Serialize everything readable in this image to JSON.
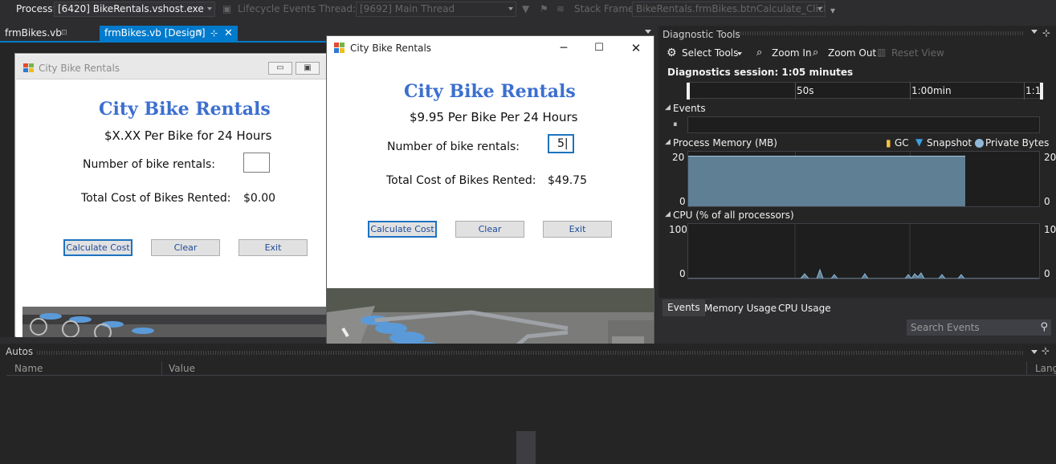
{
  "toolbar": {
    "process_label": "Process:",
    "process_value": "[6420] BikeRentals.vshost.exe",
    "lifecycle_label": "Lifecycle Events",
    "thread_label": "Thread:",
    "thread_value": "[9692] Main Thread",
    "stackframe_label": "Stack Frame:",
    "stackframe_value": "BikeRentals.frmBikes.btnCalculate_Click"
  },
  "tabs": [
    {
      "label": "frmBikes.vb"
    },
    {
      "label": "frmBikes.vb [Design]"
    }
  ],
  "design_form": {
    "title": "City Bike Rentals",
    "heading": "City Bike Rentals",
    "price_text": "$X.XX Per Bike for 24 Hours",
    "rentals_label": "Number of bike rentals:",
    "rentals_value": "",
    "total_label": "Total Cost of Bikes Rented:",
    "total_value": "$0.00",
    "calculate_label": "Calculate Cost",
    "clear_label": "Clear",
    "exit_label": "Exit"
  },
  "run_form": {
    "title": "City Bike Rentals",
    "heading": "City Bike Rentals",
    "price_text": "$9.95 Per Bike Per 24 Hours",
    "rentals_label": "Number of bike rentals:",
    "rentals_value": "5",
    "total_label": "Total Cost of Bikes Rented:",
    "total_value": "$49.75",
    "calculate_label": "Calculate Cost",
    "clear_label": "Clear",
    "exit_label": "Exit"
  },
  "diagnostics": {
    "title": "Diagnostic Tools",
    "select_tools": "Select Tools",
    "zoom_in": "Zoom In",
    "zoom_out": "Zoom Out",
    "reset_view": "Reset View",
    "session": "Diagnostics session: 1:05 minutes",
    "ruler_ticks": [
      "50s",
      "1:00min",
      "1:1"
    ],
    "events_label": "Events",
    "memory_label": "Process Memory (MB)",
    "legend_gc": "GC",
    "legend_snapshot": "Snapshot",
    "legend_private": "Private Bytes",
    "memory_max": "20",
    "memory_min": "0",
    "cpu_label": "CPU (% of all processors)",
    "cpu_max": "100",
    "cpu_min": "0",
    "bottom_tabs": [
      "Events",
      "Memory Usage",
      "CPU Usage"
    ],
    "search_placeholder": "Search Events"
  },
  "autos": {
    "title": "Autos",
    "col_name": "Name",
    "col_value": "Value",
    "col_lang": "Lang"
  },
  "colors": {
    "accent": "#007acc",
    "heading_blue": "#3c6fcf",
    "chart_fill": "#5e7f94"
  }
}
